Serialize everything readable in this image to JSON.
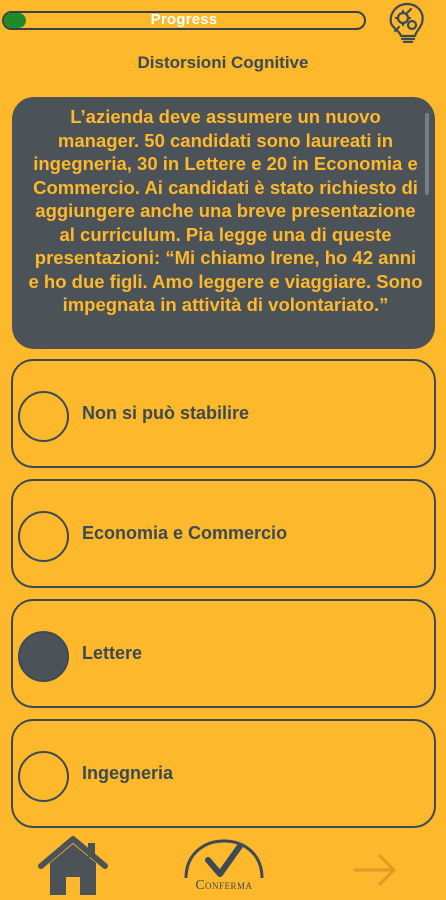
{
  "header": {
    "progress_label": "Progress",
    "progress_fraction": 0.06,
    "progress_color": "#1f8a28",
    "help_icon": "lightbulb-gears-icon"
  },
  "category": "Distorsioni Cognitive",
  "question": {
    "text": "L’azienda deve assumere un nuovo manager. 50 candidati sono laureati in ingegneria, 30 in Lettere e 20 in Economia e Commercio. Ai candidati è stato richiesto di aggiungere anche una breve presentazione al curriculum. Pia legge una di queste presentazioni: “Mi chiamo Irene, ho 42 anni e ho due figli. Amo leggere e viaggiare. Sono impegnata in attività di volontariato.”"
  },
  "options": [
    {
      "label": "Non si può stabilire",
      "selected": false
    },
    {
      "label": "Economia e Commercio",
      "selected": false
    },
    {
      "label": "Lettere",
      "selected": true
    },
    {
      "label": "Ingegneria",
      "selected": false
    }
  ],
  "footer": {
    "home_icon": "home-icon",
    "confirm_label": "Conferma",
    "next_icon": "arrow-right-icon"
  },
  "colors": {
    "background": "#FDB82B",
    "panel": "#4c5358",
    "text_dark": "#3d4a54"
  }
}
